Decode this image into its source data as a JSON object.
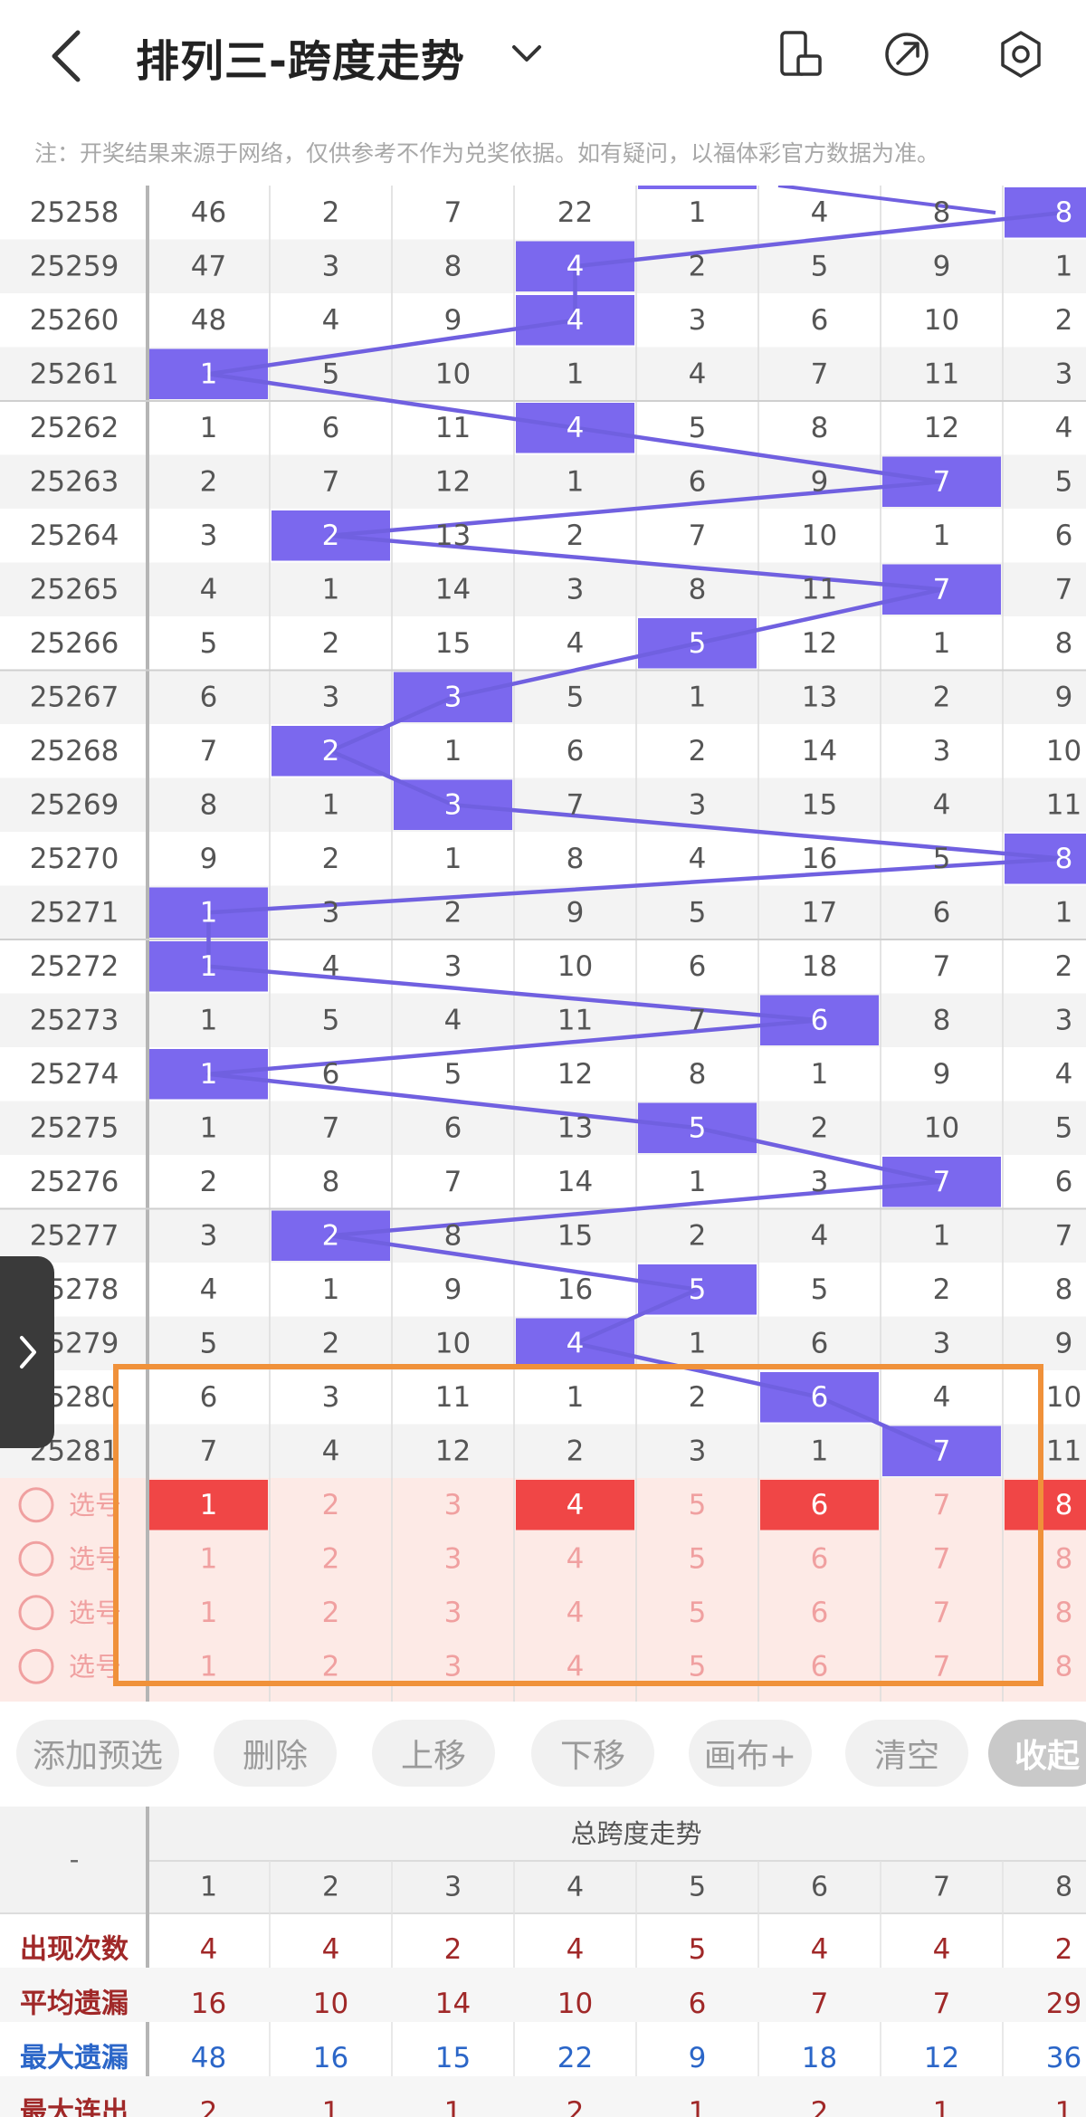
{
  "header": {
    "title": "排列三-跨度走势",
    "note": "注：开奖结果来源于网络，仅供参考不作为兑奖依据。如有疑问，以福体彩官方数据为准。"
  },
  "grid": {
    "highlight_color": "#7b68ee",
    "line_color": "#7060e0",
    "periods": [
      "25258",
      "25259",
      "25260",
      "25261",
      "25262",
      "25263",
      "25264",
      "25265",
      "25266",
      "25267",
      "25268",
      "25269",
      "25270",
      "25271",
      "25272",
      "25273",
      "25274",
      "25275",
      "25276",
      "25277",
      "25278",
      "25279",
      "25280",
      "25281"
    ],
    "rows": [
      [
        46,
        2,
        7,
        22,
        1,
        4,
        8,
        8
      ],
      [
        47,
        3,
        8,
        4,
        2,
        5,
        9,
        1
      ],
      [
        48,
        4,
        9,
        4,
        3,
        6,
        10,
        2
      ],
      [
        1,
        5,
        10,
        1,
        4,
        7,
        11,
        3
      ],
      [
        1,
        6,
        11,
        4,
        5,
        8,
        12,
        4
      ],
      [
        2,
        7,
        12,
        1,
        6,
        9,
        7,
        5
      ],
      [
        3,
        2,
        13,
        2,
        7,
        10,
        1,
        6
      ],
      [
        4,
        1,
        14,
        3,
        8,
        11,
        7,
        7
      ],
      [
        5,
        2,
        15,
        4,
        5,
        12,
        1,
        8
      ],
      [
        6,
        3,
        3,
        5,
        1,
        13,
        2,
        9
      ],
      [
        7,
        2,
        1,
        6,
        2,
        14,
        3,
        10
      ],
      [
        8,
        1,
        3,
        7,
        3,
        15,
        4,
        11
      ],
      [
        9,
        2,
        1,
        8,
        4,
        16,
        5,
        8
      ],
      [
        1,
        3,
        2,
        9,
        5,
        17,
        6,
        1
      ],
      [
        1,
        4,
        3,
        10,
        6,
        18,
        7,
        2
      ],
      [
        1,
        5,
        4,
        11,
        7,
        6,
        8,
        3
      ],
      [
        1,
        6,
        5,
        12,
        8,
        1,
        9,
        4
      ],
      [
        1,
        7,
        6,
        13,
        5,
        2,
        10,
        5
      ],
      [
        2,
        8,
        7,
        14,
        1,
        3,
        7,
        6
      ],
      [
        3,
        2,
        8,
        15,
        2,
        4,
        1,
        7
      ],
      [
        4,
        1,
        9,
        16,
        5,
        5,
        2,
        8
      ],
      [
        5,
        2,
        10,
        4,
        1,
        6,
        3,
        9
      ],
      [
        6,
        3,
        11,
        1,
        2,
        6,
        4,
        10
      ],
      [
        7,
        4,
        12,
        2,
        3,
        1,
        7,
        11
      ]
    ],
    "draw_spans": [
      8,
      4,
      4,
      1,
      4,
      7,
      2,
      7,
      5,
      3,
      2,
      3,
      8,
      1,
      1,
      6,
      1,
      5,
      7,
      2,
      5,
      4,
      6,
      7
    ],
    "selection": {
      "label": "选号",
      "selected_color": "#f04646",
      "rows": [
        {
          "numbers": [
            "1",
            "2",
            "3",
            "4",
            "5",
            "6",
            "7",
            "8"
          ],
          "selected": [
            1,
            4,
            6,
            8
          ]
        },
        {
          "numbers": [
            "1",
            "2",
            "3",
            "4",
            "5",
            "6",
            "7",
            "8"
          ],
          "selected": []
        },
        {
          "numbers": [
            "1",
            "2",
            "3",
            "4",
            "5",
            "6",
            "7",
            "8"
          ],
          "selected": []
        },
        {
          "numbers": [
            "1",
            "2",
            "3",
            "4",
            "5",
            "6",
            "7",
            "8"
          ],
          "selected": []
        }
      ]
    },
    "box_color": "#f0913a"
  },
  "actions": [
    {
      "label": "添加预选"
    },
    {
      "label": "删除"
    },
    {
      "label": "上移"
    },
    {
      "label": "下移"
    },
    {
      "label": "画布+"
    },
    {
      "label": "清空"
    },
    {
      "label": "收起"
    }
  ],
  "stats": {
    "corner": "-",
    "section_title": "总跨度走势",
    "columns": [
      "1",
      "2",
      "3",
      "4",
      "5",
      "6",
      "7",
      "8"
    ],
    "rows": [
      {
        "label": "出现次数",
        "color": "#a02828",
        "values": [
          4,
          4,
          2,
          4,
          5,
          4,
          4,
          2
        ]
      },
      {
        "label": "平均遗漏",
        "color": "#a02828",
        "values": [
          16,
          10,
          14,
          10,
          6,
          7,
          7,
          29
        ]
      },
      {
        "label": "最大遗漏",
        "color": "#2b66c8",
        "values": [
          48,
          16,
          15,
          22,
          9,
          18,
          12,
          36
        ]
      },
      {
        "label": "最大连出",
        "color": "#a02828",
        "values": [
          2,
          1,
          1,
          2,
          1,
          2,
          1,
          1
        ]
      }
    ]
  }
}
